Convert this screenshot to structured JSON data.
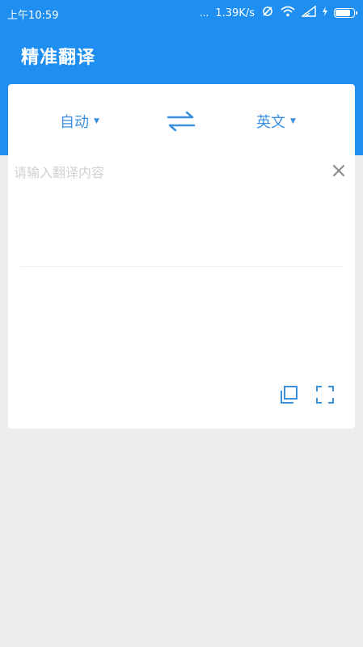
{
  "status_bar": {
    "time": "上午10:59",
    "dots": "...",
    "speed": "1.39K/s"
  },
  "app": {
    "title": "精准翻译",
    "accent_color": "#1e8ff0",
    "link_color": "#3a8fde"
  },
  "language_bar": {
    "source_label": "自动",
    "target_label": "英文",
    "swap_icon": "swap-arrows-icon"
  },
  "input": {
    "placeholder": "请输入翻译内容",
    "value": ""
  },
  "result_actions": {
    "copy_icon": "copy-icon",
    "expand_icon": "fullscreen-icon"
  }
}
